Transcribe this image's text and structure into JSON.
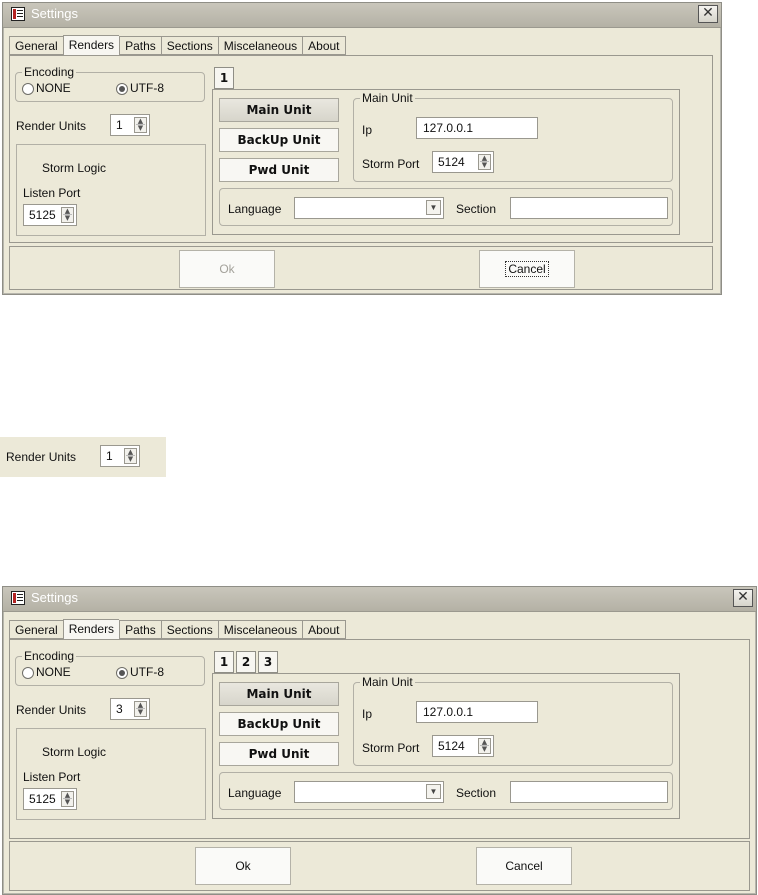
{
  "dialog1": {
    "title": "Settings",
    "close_glyph": "✕",
    "tabs": [
      "General",
      "Renders",
      "Paths",
      "Sections",
      "Miscelaneous",
      "About"
    ],
    "active_tab": "Renders",
    "encoding": {
      "legend": "Encoding",
      "options": [
        "NONE",
        "UTF-8"
      ],
      "selected": "UTF-8"
    },
    "render_units_label": "Render Units",
    "render_units_value": "1",
    "storm_logic": {
      "title": "Storm Logic",
      "listen_port_label": "Listen Port",
      "listen_port_value": "5125"
    },
    "unit_tabs": [
      "1"
    ],
    "unit_buttons": [
      "Main Unit",
      "BackUp Unit",
      "Pwd Unit"
    ],
    "main_unit": {
      "legend": "Main Unit",
      "ip_label": "Ip",
      "ip_value": "127.0.0.1",
      "storm_port_label": "Storm Port",
      "storm_port_value": "5124"
    },
    "language_label": "Language",
    "language_value": "",
    "section_label": "Section",
    "section_value": "",
    "ok_label": "Ok",
    "ok_enabled": false,
    "cancel_label": "Cancel"
  },
  "crop": {
    "render_units_label": "Render Units",
    "render_units_value": "1"
  },
  "dialog2": {
    "title": "Settings",
    "close_glyph": "✕",
    "tabs": [
      "General",
      "Renders",
      "Paths",
      "Sections",
      "Miscelaneous",
      "About"
    ],
    "active_tab": "Renders",
    "encoding": {
      "legend": "Encoding",
      "options": [
        "NONE",
        "UTF-8"
      ],
      "selected": "UTF-8"
    },
    "render_units_label": "Render Units",
    "render_units_value": "3",
    "storm_logic": {
      "title": "Storm Logic",
      "listen_port_label": "Listen Port",
      "listen_port_value": "5125"
    },
    "unit_tabs": [
      "1",
      "2",
      "3"
    ],
    "unit_buttons": [
      "Main Unit",
      "BackUp Unit",
      "Pwd Unit"
    ],
    "main_unit": {
      "legend": "Main Unit",
      "ip_label": "Ip",
      "ip_value": "127.0.0.1",
      "storm_port_label": "Storm Port",
      "storm_port_value": "5124"
    },
    "language_label": "Language",
    "language_value": "",
    "section_label": "Section",
    "section_value": "",
    "ok_label": "Ok",
    "ok_enabled": true,
    "cancel_label": "Cancel"
  }
}
